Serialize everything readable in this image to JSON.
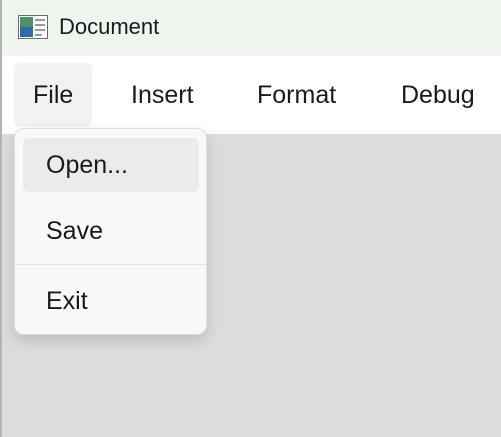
{
  "window": {
    "title": "Document",
    "icon": "document-app-icon"
  },
  "menubar": {
    "items": [
      {
        "label": "File",
        "active": true
      },
      {
        "label": "Insert"
      },
      {
        "label": "Format"
      },
      {
        "label": "Debug"
      }
    ]
  },
  "file_menu": {
    "items": [
      {
        "label": "Open...",
        "highlighted": true
      },
      {
        "label": "Save"
      },
      {
        "label": "Exit"
      }
    ]
  },
  "colors": {
    "titlebar_bg": "#eef4ee",
    "menubar_bg": "#ffffff",
    "content_bg": "#dcdcdc",
    "menu_bg": "#f9f9f9",
    "highlight_bg": "#ebebeb"
  }
}
